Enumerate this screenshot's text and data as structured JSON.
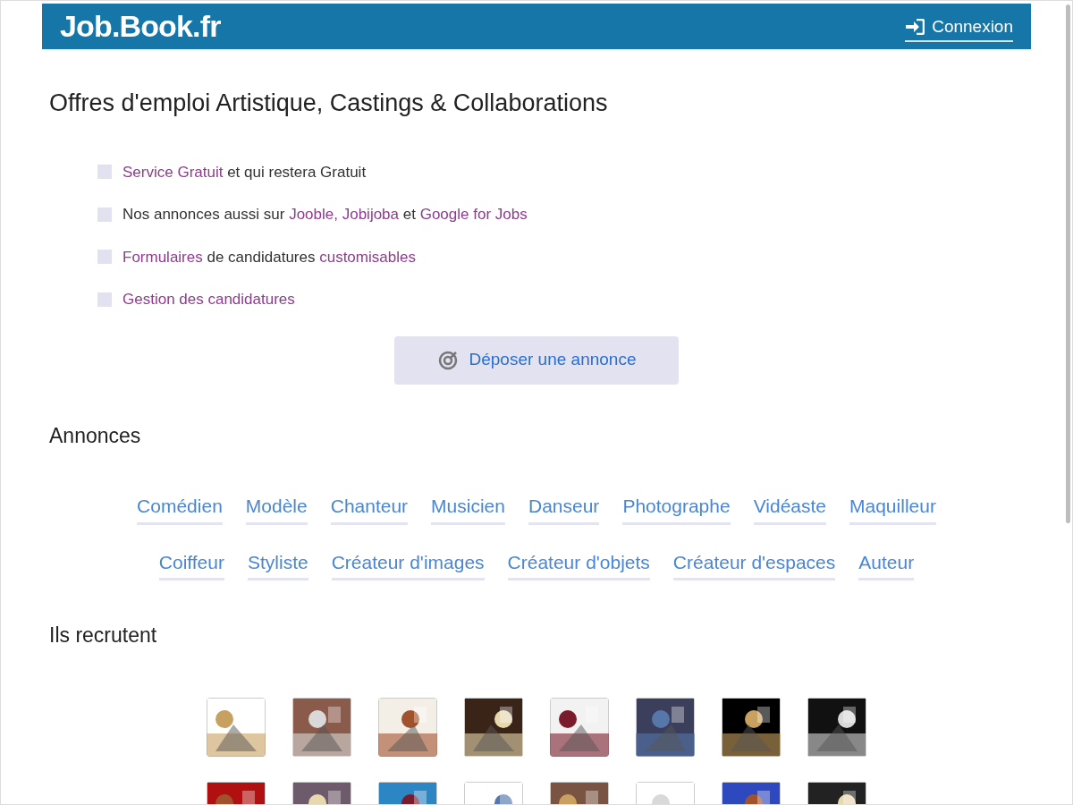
{
  "header": {
    "logo": "Job.Book.fr",
    "login": "Connexion"
  },
  "title": "Offres d'emploi Artistique, Castings & Collaborations",
  "features": [
    {
      "segments": [
        {
          "text": "Service Gratuit",
          "link": true
        },
        {
          "text": " et qui restera Gratuit",
          "link": false
        }
      ]
    },
    {
      "segments": [
        {
          "text": "Nos annonces aussi sur ",
          "link": false
        },
        {
          "text": "Jooble, Jobijoba",
          "link": true
        },
        {
          "text": " et ",
          "link": false
        },
        {
          "text": "Google for Jobs",
          "link": true
        }
      ]
    },
    {
      "segments": [
        {
          "text": "Formulaires",
          "link": true
        },
        {
          "text": " de candidatures ",
          "link": false
        },
        {
          "text": "customisables",
          "link": true
        }
      ]
    },
    {
      "segments": [
        {
          "text": "Gestion des candidatures",
          "link": true
        }
      ]
    }
  ],
  "post_button": "Déposer une annonce",
  "ads_heading": "Annonces",
  "categories": [
    [
      "Comédien",
      "Modèle",
      "Chanteur",
      "Musicien",
      "Danseur",
      "Photographe",
      "Vidéaste",
      "Maquilleur"
    ],
    [
      "Coiffeur",
      "Styliste",
      "Créateur d'images",
      "Créateur d'objets",
      "Créateur d'espaces",
      "Auteur"
    ]
  ],
  "recruiters_heading": "Ils recrutent"
}
